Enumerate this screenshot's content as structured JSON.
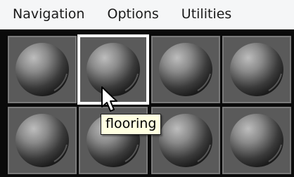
{
  "menubar": {
    "items": [
      "Navigation",
      "Options",
      "Utilities"
    ]
  },
  "materials": {
    "rows": 2,
    "columns": 4,
    "selected_index": 1,
    "tooltip": "flooring"
  },
  "icons": {
    "cursor": "mouse-pointer-icon",
    "swatch": "material-sphere-icon"
  },
  "colors": {
    "grid_background": "#0a0a0a",
    "cell_background": "#5a5a5a",
    "selected_border": "#ffffff",
    "tooltip_background": "#ffffe1"
  }
}
